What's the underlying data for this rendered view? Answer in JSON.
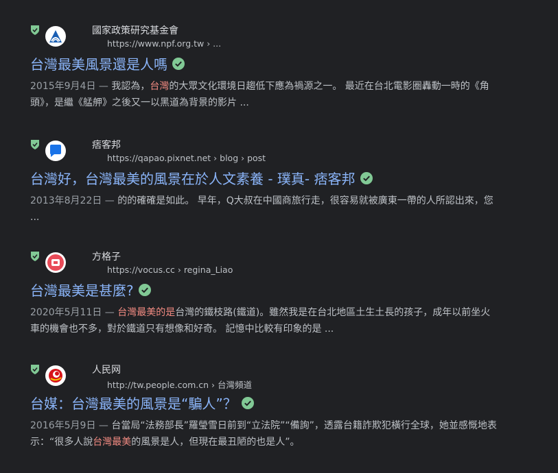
{
  "results": [
    {
      "site_name": "國家政策研究基金會",
      "url": "https://www.npf.org.tw › ...",
      "title": "台灣最美風景還是人嗎",
      "date": "2015年9月4日 — ",
      "snippet_parts": [
        "我認為，",
        "台灣",
        "的大眾文化環境日趨低下應為禍源之一。 最近在台北電影圈轟動一時的《角頭》，是繼《艋舺》之後又一以黑道為背景的影片 ..."
      ],
      "favicon": "npf-logo-icon"
    },
    {
      "site_name": "痞客邦",
      "url": "https://qapao.pixnet.net › blog › post",
      "title": "台灣好，台灣最美的風景在於人文素養 - 璞真- 痞客邦",
      "date": "2013年8月22日 — ",
      "snippet_parts": [
        "的的確確是如此。 早年，Q大叔在中國商旅行走，很容易就被廣東一帶的人所認出來，您 ...",
        "",
        ""
      ],
      "favicon": "pixnet-logo-icon"
    },
    {
      "site_name": "方格子",
      "url": "https://vocus.cc › regina_Liao",
      "title": "台灣最美是甚麼?",
      "date": "2020年5月11日 — ",
      "snippet_parts": [
        "",
        "台灣最美的是",
        "台灣的鐵枝路(鐵道)。雖然我是在台北地區土生土長的孩子，成年以前坐火車的機會也不多，對於鐵道只有想像和好奇。 記憶中比較有印象的是 ..."
      ],
      "favicon": "vocus-logo-icon"
    },
    {
      "site_name": "人民网",
      "url": "http://tw.people.com.cn › 台灣頻道",
      "title": "台媒：台灣最美的風景是“騙人”？",
      "date": "2016年5月9日 — ",
      "snippet_parts": [
        "台當局“法務部長”羅瑩雪日前到“立法院”“備詢”，透露台籍詐欺犯橫行全球，她並感慨地表示：“很多人說",
        "台灣最美",
        "的風景是人，但現在最丑陋的也是人”。"
      ],
      "favicon": "people-logo-icon"
    }
  ],
  "colors": {
    "background": "#202124",
    "title_link": "#8ab4f8",
    "highlight": "#f28b82",
    "verified_badge": "#81c995",
    "shield": "#81c995"
  }
}
